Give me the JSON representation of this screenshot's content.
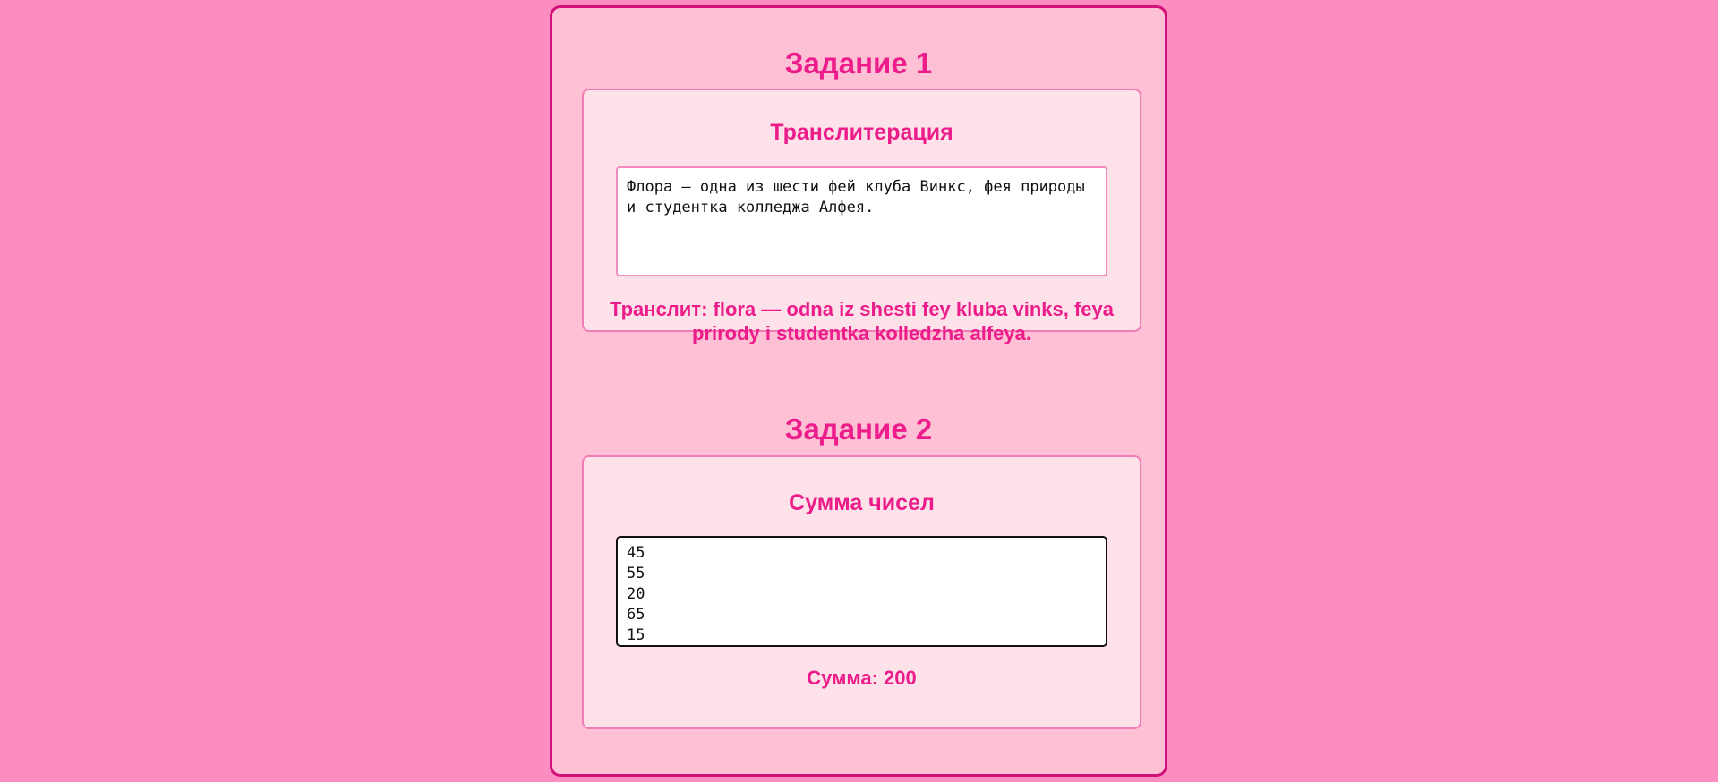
{
  "task1": {
    "heading": "Задание 1",
    "card_title": "Транслитерация",
    "input_value": "Флора — одна из шести фей клуба Винкс, фея природы и студентка колледжа Алфея.",
    "result_label": "Транслит: ",
    "result_value": "flora — odna iz shesti fey kluba vinks, feya prirody i studentka kolledzha alfeya."
  },
  "task2": {
    "heading": "Задание 2",
    "card_title": "Сумма чисел",
    "input_value": "45\n55\n20\n65\n15",
    "result_label": "Сумма: ",
    "result_value": "200"
  },
  "colors": {
    "page_background": "#fb8dc0",
    "container_background": "#fec0d5",
    "container_border": "#d2117a",
    "card_background": "#fee2e9",
    "card_border": "#f27cb6",
    "accent_text": "#ec1d8a"
  }
}
